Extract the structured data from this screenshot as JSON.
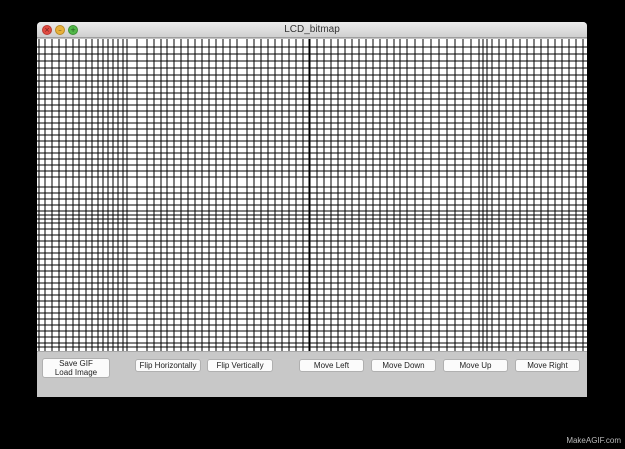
{
  "window": {
    "title": "LCD_bitmap"
  },
  "traffic_icons": {
    "close": "close-icon",
    "minimize": "minimize-icon",
    "zoom": "zoom-icon"
  },
  "controls": {
    "save_gif": "Save GIF",
    "load_image": "Load Image",
    "flip_horizontally": "Flip Horizontally",
    "flip_vertically": "Flip Vertically",
    "move_left": "Move Left",
    "move_down": "Move Down",
    "move_up": "Move Up",
    "move_right": "Move Right"
  },
  "watermark": "MakeAGIF.com",
  "colors": {
    "grid_line": "#000000",
    "grid_background": "#ffffff",
    "window_chrome": "#c4c4c4",
    "desktop": "#000000"
  }
}
